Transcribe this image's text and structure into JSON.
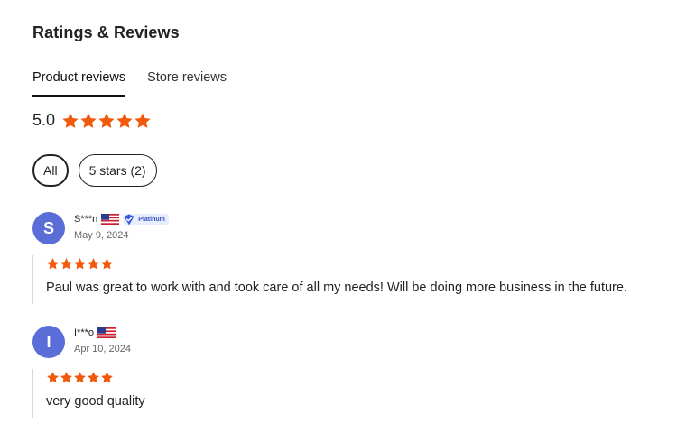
{
  "header": {
    "title": "Ratings & Reviews"
  },
  "tabs": [
    {
      "label": "Product reviews",
      "active": true
    },
    {
      "label": "Store reviews",
      "active": false
    }
  ],
  "summary": {
    "score": "5.0",
    "stars": 5,
    "star_color": "#f05a0a"
  },
  "filters": [
    {
      "label": "All",
      "active": true
    },
    {
      "label": "5 stars (2)",
      "active": false
    }
  ],
  "reviews": [
    {
      "initial": "S",
      "name": "S***n",
      "country_flag": "us-flag-icon",
      "badge": "Platinum",
      "date": "May 9, 2024",
      "stars": 5,
      "text": "Paul was great to work with and took care of all my needs! Will be doing more business in the future."
    },
    {
      "initial": "I",
      "name": "I***o",
      "country_flag": "us-flag-icon",
      "date": "Apr 10, 2024",
      "stars": 5,
      "text": "very good quality"
    }
  ],
  "colors": {
    "accent_star": "#f05a0a",
    "avatar": "#5b6ed8",
    "badge_bg": "#e6edfd",
    "badge_text": "#3a4fc4"
  }
}
